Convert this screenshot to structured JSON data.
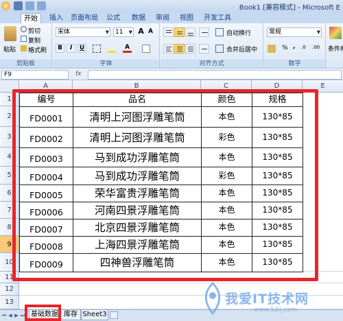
{
  "window": {
    "title": "Book1 [兼容模式] - Microsoft E"
  },
  "ribbon_tabs": [
    {
      "label": "开始",
      "active": true
    },
    {
      "label": "插入"
    },
    {
      "label": "页面布局"
    },
    {
      "label": "公式"
    },
    {
      "label": "数据"
    },
    {
      "label": "审阅"
    },
    {
      "label": "视图"
    },
    {
      "label": "开发工具"
    }
  ],
  "clipboard": {
    "paste": "粘贴",
    "cut": "剪切",
    "copy": "复制",
    "format_painter": "格式刷",
    "group": "剪贴板"
  },
  "font": {
    "name": "宋体",
    "size": "11",
    "group": "字体",
    "bold": "B",
    "italic": "I",
    "underline": "U",
    "grow": "A",
    "shrink": "A",
    "color_a": "A"
  },
  "alignment": {
    "wrap": "自动换行",
    "merge": "合并后居中",
    "group": "对齐方式"
  },
  "number": {
    "format": "常规",
    "percent": "%",
    "comma": ",",
    "group": "数字"
  },
  "styles": {
    "conditional": "条件格式"
  },
  "formula_bar": {
    "name_box": "F9",
    "fx": "fx"
  },
  "columns": [
    "A",
    "B",
    "C",
    "D",
    "E"
  ],
  "rows": [
    "1",
    "2",
    "3",
    "4",
    "5",
    "6",
    "7",
    "8",
    "9",
    "10",
    "11",
    "12",
    "13"
  ],
  "table": {
    "headers": [
      "编号",
      "品名",
      "颜色",
      "规格"
    ],
    "rows": [
      [
        "FD0001",
        "清明上河图浮雕笔筒",
        "本色",
        "130*85"
      ],
      [
        "FD0002",
        "清明上河图浮雕笔筒",
        "彩色",
        "130*85"
      ],
      [
        "FD0003",
        "马到成功浮雕笔筒",
        "本色",
        "130*85"
      ],
      [
        "FD0004",
        "马到成功浮雕笔筒",
        "彩色",
        "130*85"
      ],
      [
        "FD0005",
        "荣华富贵浮雕笔筒",
        "本色",
        "130*85"
      ],
      [
        "FD0006",
        "河南四景浮雕笔筒",
        "本色",
        "130*85"
      ],
      [
        "FD0007",
        "北京四景浮雕笔筒",
        "本色",
        "130*85"
      ],
      [
        "FD0008",
        "上海四景浮雕笔筒",
        "本色",
        "130*85"
      ],
      [
        "FD0009",
        "四神兽浮雕笔筒",
        "本色",
        "130*85"
      ]
    ]
  },
  "sheets": [
    {
      "label": "基础数据",
      "active": true
    },
    {
      "label": "库存"
    },
    {
      "label": "Sheet3"
    }
  ],
  "watermark": {
    "text": "我爱IT技术网",
    "sub": "www.52ij.com"
  },
  "colors": {
    "highlight": "#e8252b",
    "selected_row": "#f8c978"
  }
}
